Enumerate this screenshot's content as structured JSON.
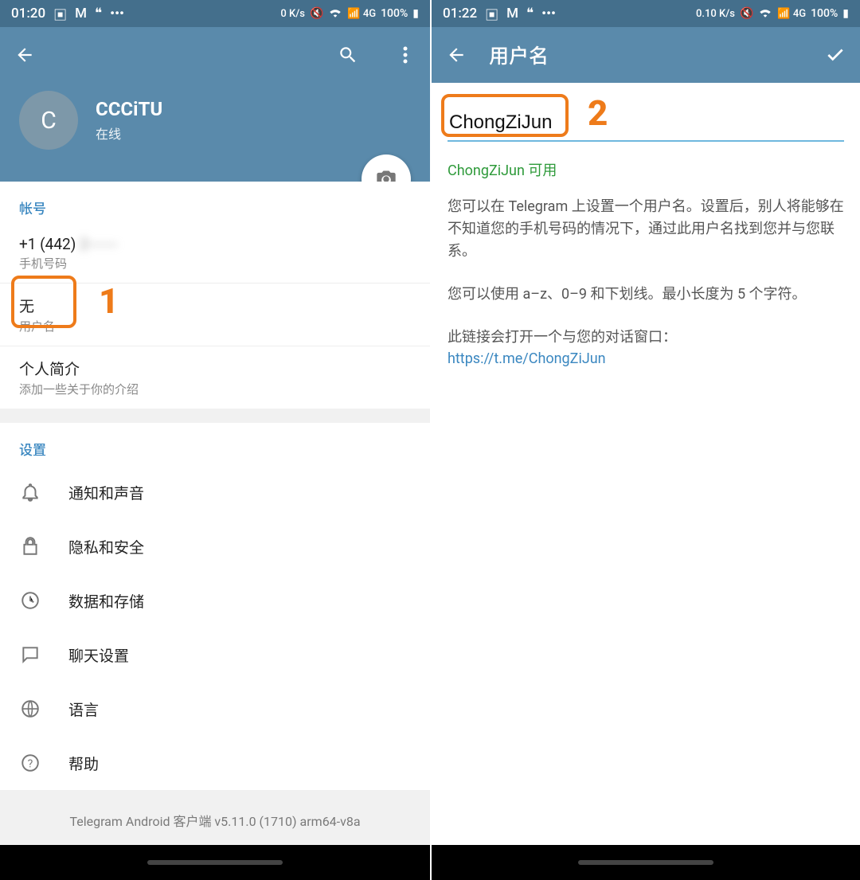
{
  "colors": {
    "accent": "#5a8aab",
    "highlight": "#ee7b1a",
    "link": "#3a87c0",
    "ok": "#2e9a3a"
  },
  "left": {
    "status": {
      "time": "01:20",
      "net": "0 K/s",
      "sig": "4G",
      "battery": "100%"
    },
    "profile": {
      "avatar_initial": "C",
      "name": "CCCiTU",
      "status": "在线"
    },
    "account": {
      "header": "帐号",
      "phone_value": "+1 (442)",
      "phone_hidden": "2-------",
      "phone_label": "手机号码",
      "username_value": "无",
      "username_label": "用户名",
      "bio_value": "个人简介",
      "bio_label": "添加一些关于你的介绍"
    },
    "settings": {
      "header": "设置",
      "items": [
        {
          "label": "通知和声音",
          "icon": "bell-icon"
        },
        {
          "label": "隐私和安全",
          "icon": "lock-icon"
        },
        {
          "label": "数据和存储",
          "icon": "clock-icon"
        },
        {
          "label": "聊天设置",
          "icon": "chat-icon"
        },
        {
          "label": "语言",
          "icon": "globe-icon"
        },
        {
          "label": "帮助",
          "icon": "help-icon"
        }
      ]
    },
    "footer": "Telegram Android 客户端 v5.11.0 (1710) arm64-v8a",
    "annotation": "1"
  },
  "right": {
    "status": {
      "time": "01:22",
      "net": "0.10 K/s",
      "sig": "4G",
      "battery": "100%"
    },
    "title": "用户名",
    "input_value": "ChongZiJun",
    "available_text": "ChongZiJun 可用",
    "desc1": "您可以在 Telegram 上设置一个用户名。设置后，别人将能够在不知道您的手机号码的情况下，通过此用户名找到您并与您联系。",
    "desc2": "您可以使用 a–z、0–9 和下划线。最小长度为 5 个字符。",
    "desc3": "此链接会打开一个与您的对话窗口：",
    "link": "https://t.me/ChongZiJun",
    "annotation": "2"
  }
}
